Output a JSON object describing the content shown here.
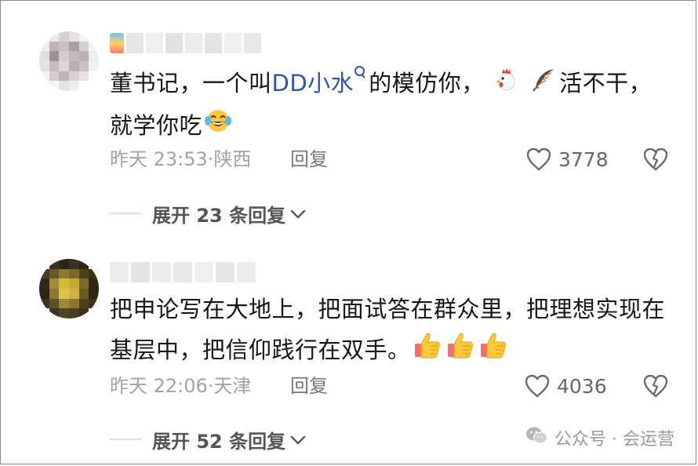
{
  "comments": [
    {
      "text_parts": {
        "lead": "董书记，一个叫",
        "mention": "DD小水",
        "after_mention": "的模仿你，",
        "after_emoji": "活不干，",
        "line2": "就学你吃"
      },
      "emoji_names": [
        "rooster-icon",
        "feather-icon",
        "laughing-tears-icon"
      ],
      "time": "昨天 23:53",
      "separator": "·",
      "location": "陕西",
      "reply_label": "回复",
      "likes": "3778",
      "expand_label": "展开 23 条回复"
    },
    {
      "text_parts": {
        "line1": "把申论写在大地上，把面试答在群众里，把理想实现在",
        "line2": "基层中，把信仰践行在双手。"
      },
      "emoji_names": [
        "thumbs-up-icon",
        "thumbs-up-icon",
        "thumbs-up-icon"
      ],
      "time": "昨天 22:06",
      "separator": "·",
      "location": "天津",
      "reply_label": "回复",
      "likes": "4036",
      "expand_label": "展开 52 条回复"
    }
  ],
  "watermark": {
    "text": "公众号 · 会运营",
    "icon": "wechat-icon"
  },
  "colors": {
    "mention": "#2a55b0",
    "meta": "#a3a3a3",
    "text": "#161616"
  }
}
